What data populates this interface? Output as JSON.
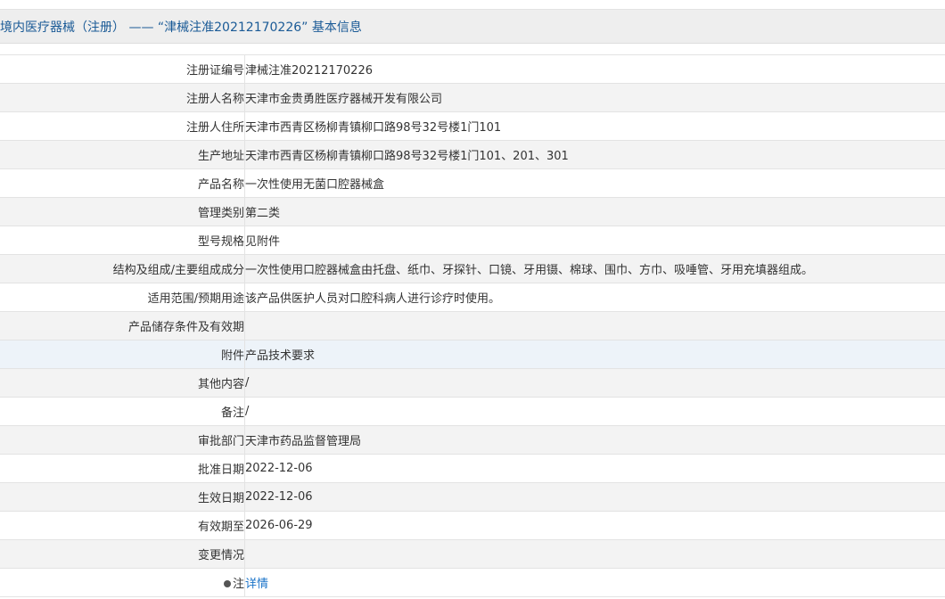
{
  "header": {
    "title": "境内医疗器械（注册） —— “津械注准20212170226” 基本信息"
  },
  "rows": [
    {
      "label": "注册证编号",
      "value": "津械注准20212170226"
    },
    {
      "label": "注册人名称",
      "value": "天津市金贵勇胜医疗器械开发有限公司"
    },
    {
      "label": "注册人住所",
      "value": "天津市西青区杨柳青镇柳口路98号32号楼1门101"
    },
    {
      "label": "生产地址",
      "value": "天津市西青区杨柳青镇柳口路98号32号楼1门101、201、301"
    },
    {
      "label": "产品名称",
      "value": "一次性使用无菌口腔器械盒"
    },
    {
      "label": "管理类别",
      "value": "第二类"
    },
    {
      "label": "型号规格",
      "value": "见附件"
    },
    {
      "label": "结构及组成/主要组成成分",
      "value": "一次性使用口腔器械盒由托盘、纸巾、牙探针、口镜、牙用镊、棉球、围巾、方巾、吸唾管、牙用充填器组成。"
    },
    {
      "label": "适用范围/预期用途",
      "value": "该产品供医护人员对口腔科病人进行诊疗时使用。"
    },
    {
      "label": "产品储存条件及有效期",
      "value": ""
    },
    {
      "label": "附件",
      "value": "产品技术要求"
    },
    {
      "label": "其他内容",
      "value": "/"
    },
    {
      "label": "备注",
      "value": "/"
    },
    {
      "label": "审批部门",
      "value": "天津市药品监督管理局"
    },
    {
      "label": "批准日期",
      "value": "2022-12-06"
    },
    {
      "label": "生效日期",
      "value": "2022-12-06"
    },
    {
      "label": "有效期至",
      "value": "2026-06-29"
    },
    {
      "label": "变更情况",
      "value": ""
    },
    {
      "label": "注",
      "value": "详情"
    }
  ],
  "note_icon": "info-dot-icon"
}
